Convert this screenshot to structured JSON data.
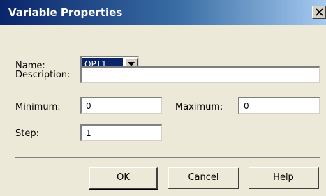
{
  "window": {
    "title": "Variable Properties",
    "close_glyph": "X"
  },
  "form": {
    "name_label": "Name:",
    "name_value": "OPT1",
    "description_label": "Description:",
    "description_value": "",
    "minimum_label": "Minimum:",
    "minimum_value": "0",
    "maximum_label": "Maximum:",
    "maximum_value": "0",
    "step_label": "Step:",
    "step_value": "1"
  },
  "buttons": {
    "ok_label": "OK",
    "cancel_label": "Cancel",
    "help_label": "Help"
  },
  "colors": {
    "titlebar_start": "#0a246a",
    "titlebar_end": "#a6caf0",
    "dialog_background": "#ece9d8",
    "selection_background": "#0a246a",
    "selection_text": "#ffffff"
  },
  "icons": {
    "close": "close-icon",
    "dropdown": "chevron-down-icon"
  }
}
